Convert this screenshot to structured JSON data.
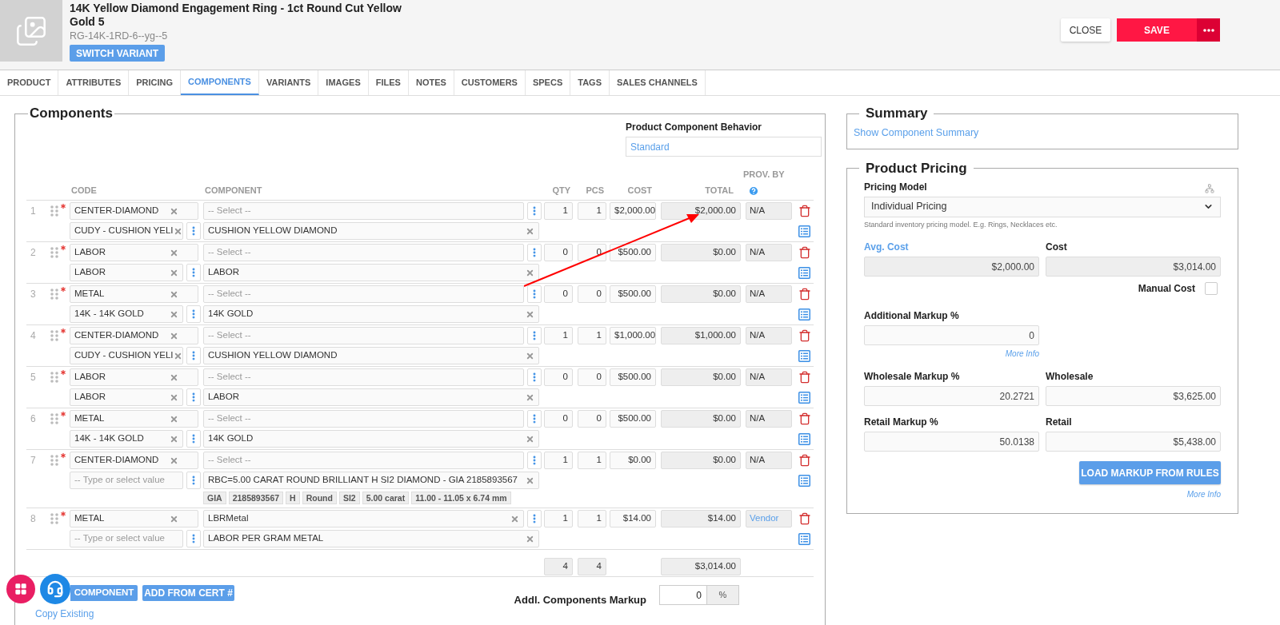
{
  "product": {
    "title": "14K Yellow Diamond Engagement Ring - 1ct Round Cut Yellow Gold 5",
    "sku": "RG-14K-1RD-6--yg--5",
    "switch_button": "SWITCH VARIANT"
  },
  "actions": {
    "close": "CLOSE",
    "save": "SAVE"
  },
  "tabs": [
    {
      "label": "PRODUCT",
      "selected": false
    },
    {
      "label": "ATTRIBUTES",
      "selected": false
    },
    {
      "label": "PRICING",
      "selected": false
    },
    {
      "label": "COMPONENTS",
      "selected": true
    },
    {
      "label": "VARIANTS",
      "selected": false
    },
    {
      "label": "IMAGES",
      "selected": false
    },
    {
      "label": "FILES",
      "selected": false
    },
    {
      "label": "NOTES",
      "selected": false
    },
    {
      "label": "CUSTOMERS",
      "selected": false
    },
    {
      "label": "SPECS",
      "selected": false
    },
    {
      "label": "TAGS",
      "selected": false
    },
    {
      "label": "SALES CHANNELS",
      "selected": false
    }
  ],
  "components": {
    "title": "Components",
    "behavior_label": "Product Component Behavior",
    "behavior_value": "Standard",
    "columns": {
      "code": "CODE",
      "component": "COMPONENT",
      "qty": "QTY",
      "pcs": "PCS",
      "cost": "COST",
      "total": "TOTAL",
      "prov_by": "PROV. BY"
    },
    "rows": [
      {
        "number": "1",
        "required": true,
        "code": {
          "value": "CENTER-DIAMOND"
        },
        "component": {
          "placeholder": "-- Select --"
        },
        "subcode": {
          "value": "CUDY - CUSHION YELI"
        },
        "subcomponent": "CUSHION YELLOW DIAMOND",
        "qty": "1",
        "pcs": "1",
        "cost": "$2,000.00",
        "total": "$2,000.00",
        "prov_by": {
          "text": "N/A",
          "kind": "static"
        }
      },
      {
        "number": "2",
        "required": true,
        "code": {
          "value": "LABOR"
        },
        "component": {
          "placeholder": "-- Select --"
        },
        "subcode": {
          "value": "LABOR"
        },
        "subcomponent": "LABOR",
        "qty": "0",
        "pcs": "0",
        "cost": "$500.00",
        "total": "$0.00",
        "prov_by": {
          "text": "N/A",
          "kind": "static"
        }
      },
      {
        "number": "3",
        "required": true,
        "code": {
          "value": "METAL"
        },
        "component": {
          "placeholder": "-- Select --"
        },
        "subcode": {
          "value": "14K - 14K GOLD"
        },
        "subcomponent": "14K GOLD",
        "qty": "0",
        "pcs": "0",
        "cost": "$500.00",
        "total": "$0.00",
        "prov_by": {
          "text": "N/A",
          "kind": "static"
        }
      },
      {
        "number": "4",
        "required": true,
        "code": {
          "value": "CENTER-DIAMOND"
        },
        "component": {
          "placeholder": "-- Select --"
        },
        "subcode": {
          "value": "CUDY - CUSHION YELI"
        },
        "subcomponent": "CUSHION YELLOW DIAMOND",
        "qty": "1",
        "pcs": "1",
        "cost": "$1,000.00",
        "total": "$1,000.00",
        "prov_by": {
          "text": "N/A",
          "kind": "static"
        }
      },
      {
        "number": "5",
        "required": true,
        "code": {
          "value": "LABOR"
        },
        "component": {
          "placeholder": "-- Select --"
        },
        "subcode": {
          "value": "LABOR"
        },
        "subcomponent": "LABOR",
        "qty": "0",
        "pcs": "0",
        "cost": "$500.00",
        "total": "$0.00",
        "prov_by": {
          "text": "N/A",
          "kind": "static"
        }
      },
      {
        "number": "6",
        "required": true,
        "code": {
          "value": "METAL"
        },
        "component": {
          "placeholder": "-- Select --"
        },
        "subcode": {
          "value": "14K - 14K GOLD"
        },
        "subcomponent": "14K GOLD",
        "qty": "0",
        "pcs": "0",
        "cost": "$500.00",
        "total": "$0.00",
        "prov_by": {
          "text": "N/A",
          "kind": "static"
        }
      },
      {
        "number": "7",
        "required": true,
        "code": {
          "value": "CENTER-DIAMOND"
        },
        "component": {
          "placeholder": "-- Select --"
        },
        "subcode": {
          "placeholder": "-- Type or select value"
        },
        "subcomponent": "RBC=5.00 CARAT ROUND BRILLIANT H SI2 DIAMOND - GIA 2185893567",
        "tags": [
          "GIA",
          "2185893567",
          "H",
          "Round",
          "SI2",
          "5.00 carat",
          "11.00 - 11.05 x 6.74 mm"
        ],
        "qty": "1",
        "pcs": "1",
        "cost": "$0.00",
        "total": "$0.00",
        "prov_by": {
          "text": "N/A",
          "kind": "static"
        }
      },
      {
        "number": "8",
        "required": true,
        "code": {
          "value": "METAL"
        },
        "component": {
          "value": "LBRMetal"
        },
        "subcode": {
          "placeholder": "-- Type or select value"
        },
        "subcomponent": "LABOR PER GRAM METAL",
        "qty": "1",
        "pcs": "1",
        "cost": "$14.00",
        "total": "$14.00",
        "prov_by": {
          "text": "Vendor",
          "kind": "link"
        }
      }
    ],
    "totals": {
      "qty": "4",
      "pcs": "4",
      "total": "$3,014.00"
    },
    "buttons": [
      "COMPONENT",
      "ADD FROM CERT #"
    ],
    "markup_label": "Addl. Components Markup",
    "markup_value": "0",
    "markup_unit": "%",
    "copy_link": "Copy Existing"
  },
  "summary": {
    "title": "Summary",
    "link": "Show Component Summary"
  },
  "pricing": {
    "title": "Product Pricing",
    "model_label": "Pricing Model",
    "model_value": "Individual Pricing",
    "model_hint": "Standard inventory pricing model. E.g. Rings, Necklaces etc.",
    "avg_cost_label": "Avg. Cost",
    "avg_cost": "$2,000.00",
    "cost_label": "Cost",
    "cost": "$3,014.00",
    "manual_cost_label": "Manual Cost",
    "manual_cost_checked": false,
    "additional_markup_label": "Additional Markup %",
    "additional_markup": "0",
    "more_info": "More Info",
    "wholesale_markup_label": "Wholesale Markup %",
    "wholesale_markup": "20.2721",
    "wholesale_label": "Wholesale",
    "wholesale": "$3,625.00",
    "retail_markup_label": "Retail Markup %",
    "retail_markup": "50.0138",
    "retail_label": "Retail",
    "retail": "$5,438.00",
    "load_button": "LOAD MARKUP FROM RULES",
    "more_info_2": "More Info"
  }
}
